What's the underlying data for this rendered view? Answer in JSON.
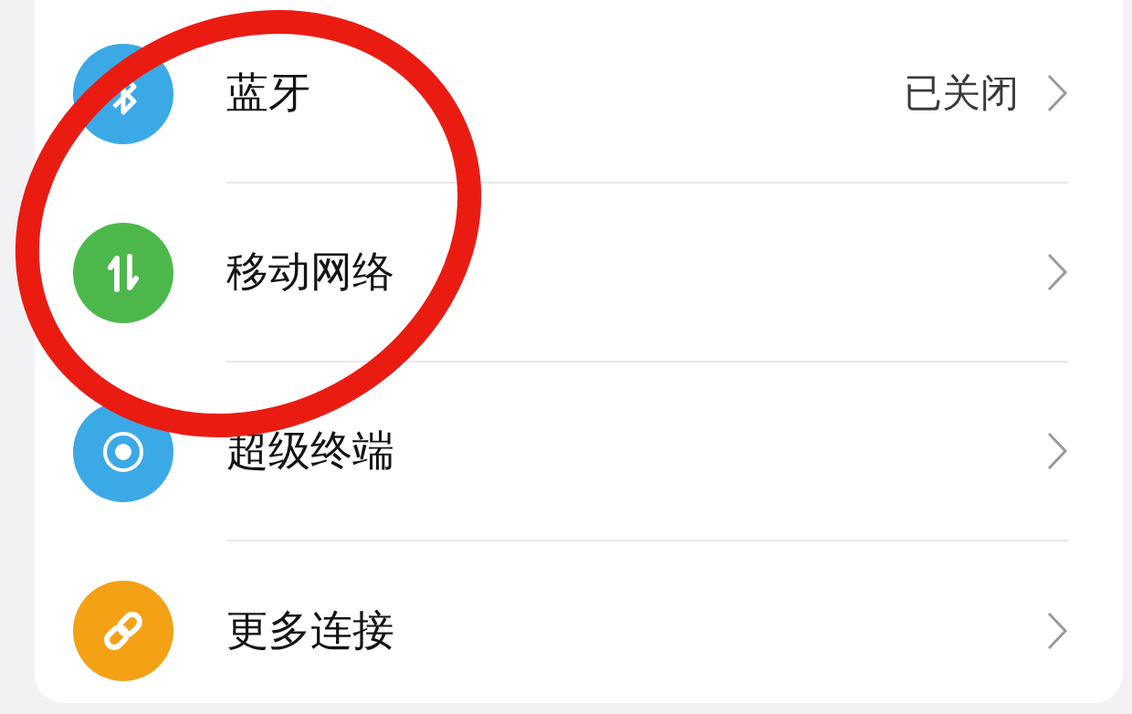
{
  "settings_list": [
    {
      "label": "蓝牙",
      "value": "已关闭",
      "color": "#3ba9e6"
    },
    {
      "label": "移动网络",
      "color": "#4cb84b"
    },
    {
      "label": "超级终端",
      "color": "#3ba9e6"
    },
    {
      "label": "更多连接",
      "color": "#f4a116"
    }
  ],
  "annotation": {
    "kind": "circle"
  }
}
